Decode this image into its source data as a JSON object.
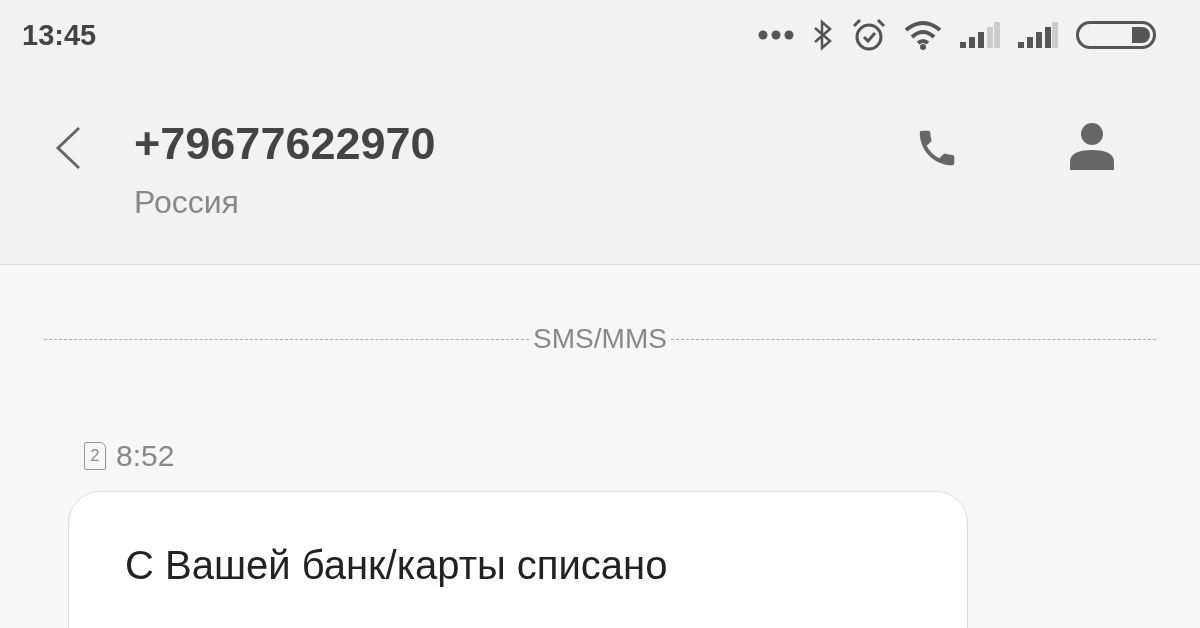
{
  "status_bar": {
    "time": "13:45"
  },
  "header": {
    "title": "+79677622970",
    "subtitle": "Россия"
  },
  "divider": {
    "label": "SMS/MMS"
  },
  "message": {
    "sim": "2",
    "time": "8:52",
    "text": "С Вашей банк/карты списано"
  }
}
